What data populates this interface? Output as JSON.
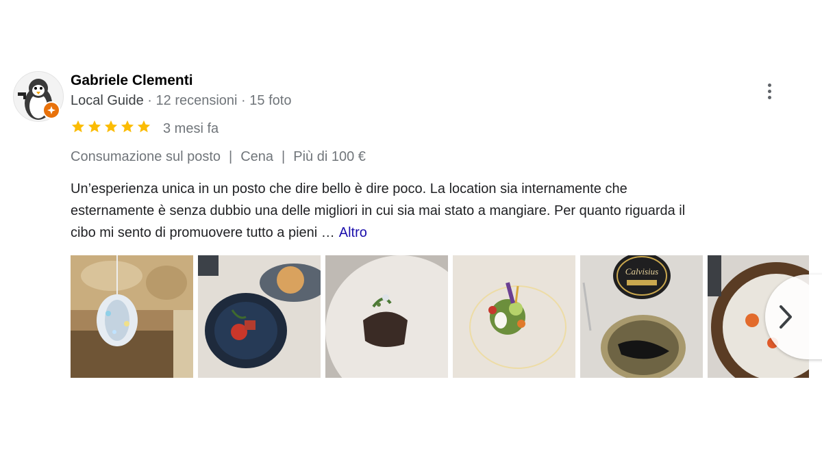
{
  "reviewer": {
    "name": "Gabriele Clementi",
    "guide_label": "Local Guide",
    "separator": " · ",
    "reviews": "12 recensioni",
    "photos": "15 foto"
  },
  "rating": {
    "stars": 5,
    "max": 5,
    "time_ago": "3 mesi fa"
  },
  "tags": [
    "Consumazione sul posto",
    "Cena",
    "Più di 100 €"
  ],
  "tag_separator": "|",
  "review_lines": [
    "Un’esperienza unica in un posto che dire bello è dire poco. La location sia internamente che",
    "esternamente è senza dubbio una delle migliori in cui sia mai stato a mangiare. Per quanto riguarda il",
    "cibo mi sento di promuovere tutto a pieni …"
  ],
  "more_link": "Altro",
  "gallery_photos": [
    {
      "subject": "chandelier-ceiling"
    },
    {
      "subject": "tomato-dish-blue-bowl"
    },
    {
      "subject": "meat-plate"
    },
    {
      "subject": "salad-plate"
    },
    {
      "subject": "caviar-tin"
    },
    {
      "subject": "egg-bowl"
    }
  ],
  "caviar_tin_label": "Calvisius",
  "colors": {
    "star": "#fbbc04",
    "link": "#1a0dab",
    "badge": "#e8710a",
    "muted": "#70757a"
  },
  "icons": {
    "menu": "more-vert-icon",
    "next": "chevron-right-icon",
    "star": "star-icon",
    "badge": "local-guide-badge-icon"
  }
}
